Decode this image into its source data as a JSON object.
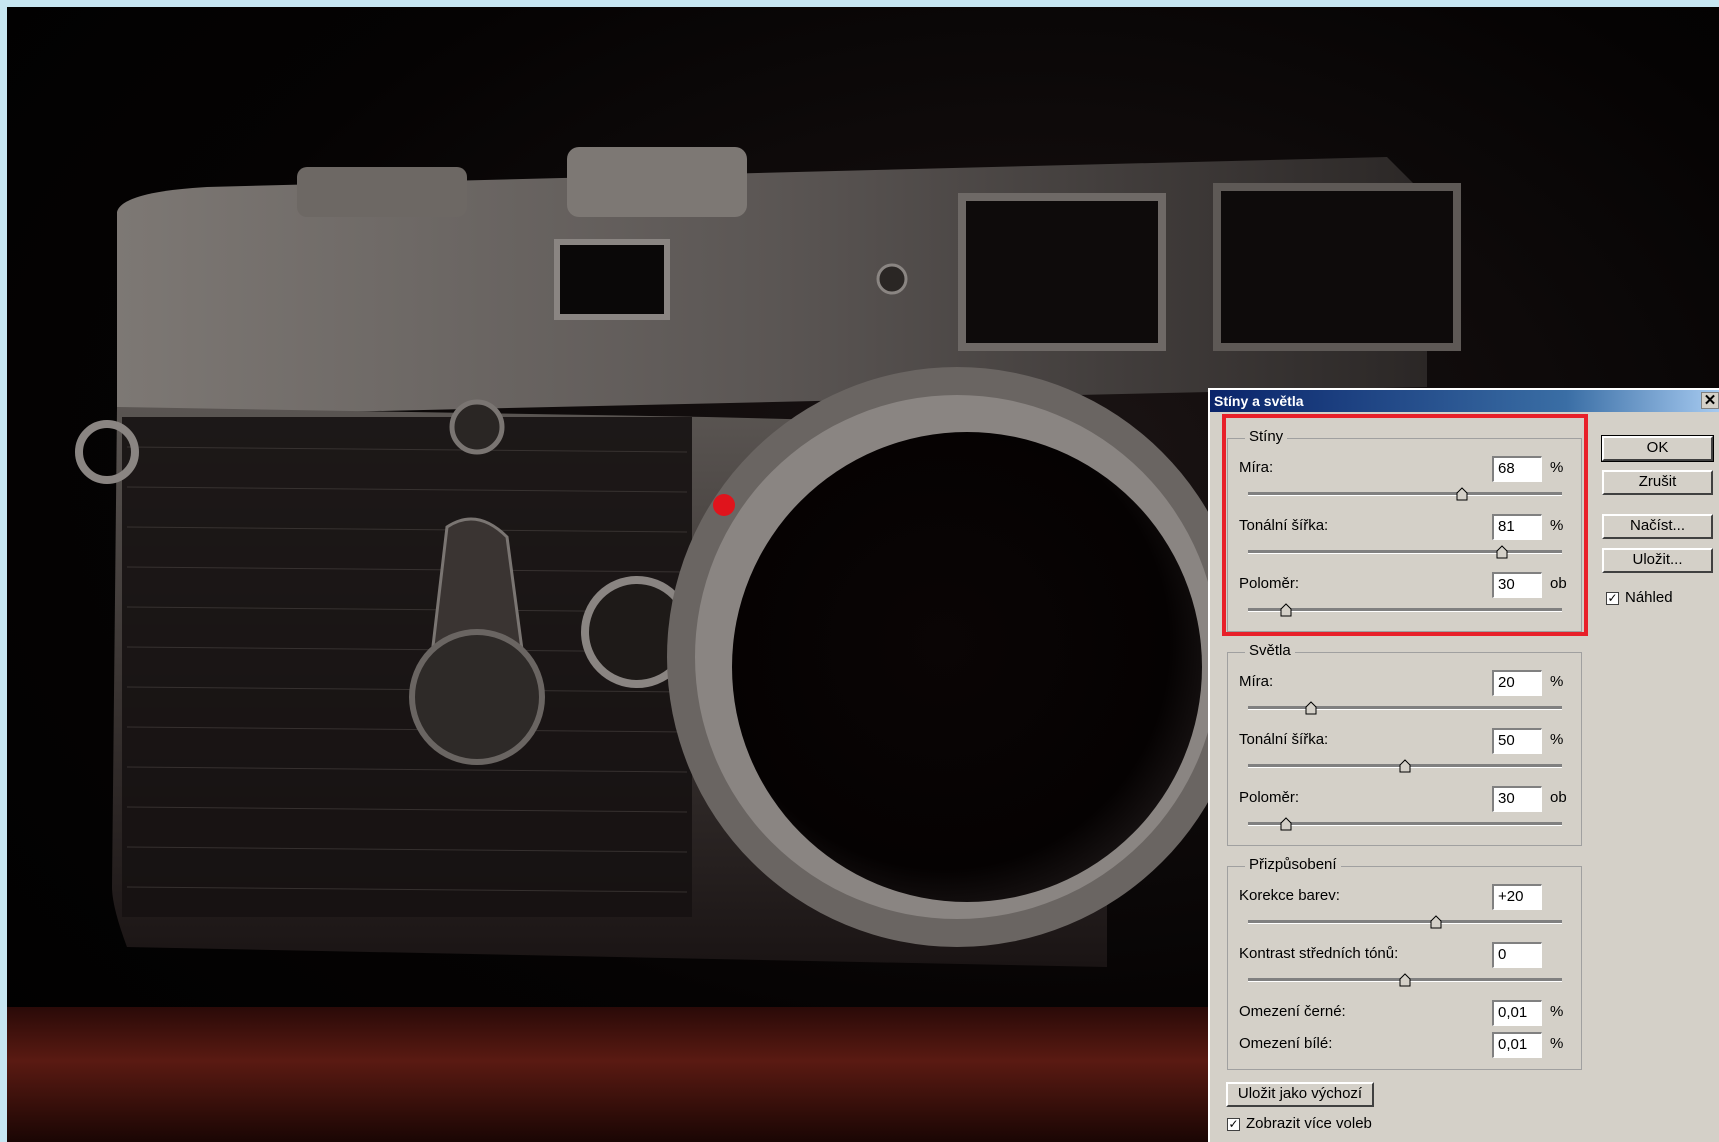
{
  "dialog": {
    "title": "Stíny a světla",
    "close_glyph": "✕",
    "buttons": {
      "ok": "OK",
      "cancel": "Zrušit",
      "load": "Načíst...",
      "save": "Uložit...",
      "save_default": "Uložit jako výchozí"
    },
    "preview": {
      "label": "Náhled",
      "checked": true
    },
    "more_options": {
      "label": "Zobrazit více voleb",
      "checked": true
    },
    "check_glyph": "✓",
    "shadows": {
      "legend": "Stíny",
      "amount": {
        "label": "Míra:",
        "value": "68",
        "unit": "%",
        "slider": 0.68
      },
      "tonal_width": {
        "label": "Tonální šířka:",
        "value": "81",
        "unit": "%",
        "slider": 0.81
      },
      "radius": {
        "label": "Poloměr:",
        "value": "30",
        "unit": "ob",
        "slider": 0.12
      }
    },
    "highlights": {
      "legend": "Světla",
      "amount": {
        "label": "Míra:",
        "value": "20",
        "unit": "%",
        "slider": 0.2
      },
      "tonal_width": {
        "label": "Tonální šířka:",
        "value": "50",
        "unit": "%",
        "slider": 0.5
      },
      "radius": {
        "label": "Poloměr:",
        "value": "30",
        "unit": "ob",
        "slider": 0.12
      }
    },
    "adjustments": {
      "legend": "Přizpůsobení",
      "color_correction": {
        "label": "Korekce barev:",
        "value": "+20",
        "slider": 0.6
      },
      "midtone_contrast": {
        "label": "Kontrast středních tónů:",
        "value": "0",
        "slider": 0.5
      },
      "black_clip": {
        "label": "Omezení černé:",
        "value": "0,01",
        "unit": "%"
      },
      "white_clip": {
        "label": "Omezení bílé:",
        "value": "0,01",
        "unit": "%"
      }
    }
  },
  "colors": {
    "highlight_frame": "#e8202a",
    "titlebar": "#0a246a",
    "dialog_bg": "#d4d0c8"
  }
}
